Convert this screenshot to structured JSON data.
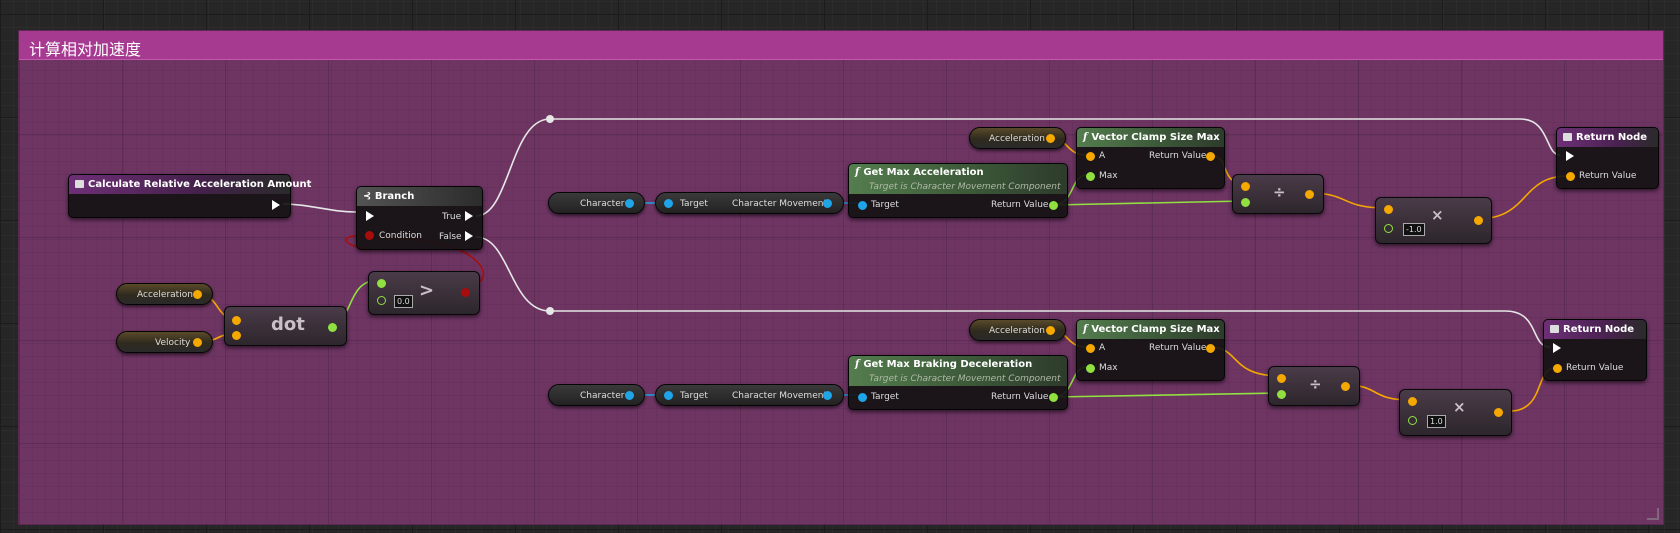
{
  "comment": {
    "title": "计算相对加速度"
  },
  "event_node": {
    "title": "Calculate Relative Acceleration Amount"
  },
  "branch": {
    "title": "Branch",
    "true_label": "True",
    "false_label": "False",
    "condition_label": "Condition"
  },
  "vars_left": {
    "acceleration": "Acceleration",
    "velocity": "Velocity"
  },
  "dot": {
    "label": "dot"
  },
  "compare": {
    "op": ">",
    "value": "0.0"
  },
  "top_row": {
    "character": "Character",
    "get_move_target": "Target",
    "get_move_out": "Character Movement",
    "func_title": "Get Max Acceleration",
    "func_subtitle": "Target is Character Movement Component",
    "func_target": "Target",
    "func_return": "Return Value",
    "acceleration": "Acceleration",
    "clamp_title": "Vector Clamp Size Max",
    "clamp_a": "A",
    "clamp_max": "Max",
    "clamp_return": "Return Value",
    "divide_op": "÷",
    "multiply_op": "×",
    "multiply_value": "-1.0",
    "return_title": "Return Node",
    "return_value": "Return Value"
  },
  "bottom_row": {
    "character": "Character",
    "get_move_target": "Target",
    "get_move_out": "Character Movement",
    "func_title": "Get Max Braking Deceleration",
    "func_subtitle": "Target is Character Movement Component",
    "func_target": "Target",
    "func_return": "Return Value",
    "acceleration": "Acceleration",
    "clamp_title": "Vector Clamp Size Max",
    "clamp_a": "A",
    "clamp_max": "Max",
    "clamp_return": "Return Value",
    "divide_op": "÷",
    "multiply_op": "×",
    "multiply_value": "1.0",
    "return_title": "Return Node",
    "return_value": "Return Value"
  },
  "colors": {
    "comment_bg": "#6e3563",
    "comment_header": "#a63a91",
    "float_pin": "#90e040",
    "vector_pin": "#f5a800",
    "object_pin": "#1fa4e8",
    "bool_pin": "#a80d0d",
    "exec_wire": "#e6e6e6"
  }
}
